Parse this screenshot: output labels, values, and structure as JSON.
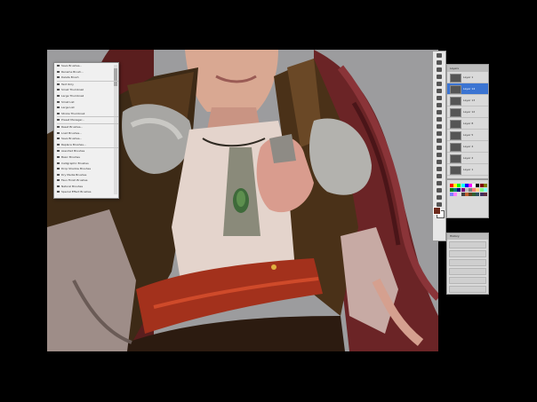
{
  "brush_menu": {
    "items": [
      {
        "label": "Save Brushes...",
        "sep": false
      },
      {
        "label": "Rename Brush...",
        "sep": false
      },
      {
        "label": "Delete Brush",
        "sep": true
      },
      {
        "label": "Text Only",
        "sep": false
      },
      {
        "label": "Small Thumbnail",
        "sep": false
      },
      {
        "label": "Large Thumbnail",
        "sep": false
      },
      {
        "label": "Small List",
        "sep": false
      },
      {
        "label": "Large List",
        "sep": false
      },
      {
        "label": "Stroke Thumbnail",
        "sep": true
      },
      {
        "label": "Preset Manager...",
        "sep": true
      },
      {
        "label": "Reset Brushes...",
        "sep": false
      },
      {
        "label": "Load Brushes...",
        "sep": false
      },
      {
        "label": "Save Brushes...",
        "sep": false
      },
      {
        "label": "Replace Brushes...",
        "sep": true
      },
      {
        "label": "Assorted Brushes",
        "sep": false
      },
      {
        "label": "Basic Brushes",
        "sep": false
      },
      {
        "label": "Calligraphic Brushes",
        "sep": false
      },
      {
        "label": "Drop Shadow Brushes",
        "sep": false
      },
      {
        "label": "Dry Media Brushes",
        "sep": false
      },
      {
        "label": "Faux Finish Brushes",
        "sep": false
      },
      {
        "label": "Natural Brushes",
        "sep": false
      },
      {
        "label": "Special Effect Brushes",
        "sep": false
      }
    ]
  },
  "layers_panel": {
    "title": "Layers",
    "layers": [
      {
        "name": "Layer 1",
        "selected": false
      },
      {
        "name": "Layer 14",
        "selected": true
      },
      {
        "name": "Layer 13",
        "selected": false
      },
      {
        "name": "Layer 12",
        "selected": false
      },
      {
        "name": "Layer 8",
        "selected": false
      },
      {
        "name": "Layer 5",
        "selected": false
      },
      {
        "name": "Layer 4",
        "selected": false
      },
      {
        "name": "Layer 2",
        "selected": false
      },
      {
        "name": "Layer 1",
        "selected": false
      }
    ]
  },
  "history_panel": {
    "title": "History"
  },
  "colors": {
    "foreground": "#6d2a1c",
    "background": "#ffffff",
    "swatches": [
      "#ff0000",
      "#ffff00",
      "#00ff00",
      "#00ffff",
      "#0000ff",
      "#ff00ff",
      "#ffffff",
      "#000000",
      "#7f0000",
      "#7f7f00",
      "#007f00",
      "#007f7f",
      "#00007f",
      "#7f007f",
      "#c0c0c0",
      "#808080",
      "#ff8080",
      "#ffd080",
      "#80ff80",
      "#80ffff",
      "#8080ff",
      "#ff80ff",
      "#e0e0e0",
      "#404040",
      "#c06030",
      "#604020",
      "#306030",
      "#305060",
      "#403060",
      "#603040"
    ]
  },
  "tools": [
    "move-icon",
    "marquee-icon",
    "lasso-icon",
    "magic-wand-icon",
    "crop-icon",
    "slice-icon",
    "healing-icon",
    "brush-icon",
    "stamp-icon",
    "history-brush-icon",
    "eraser-icon",
    "gradient-icon",
    "blur-icon",
    "dodge-icon",
    "path-icon",
    "type-icon",
    "pen-icon",
    "shape-icon",
    "notes-icon",
    "eyedropper-icon",
    "hand-icon",
    "zoom-icon"
  ]
}
